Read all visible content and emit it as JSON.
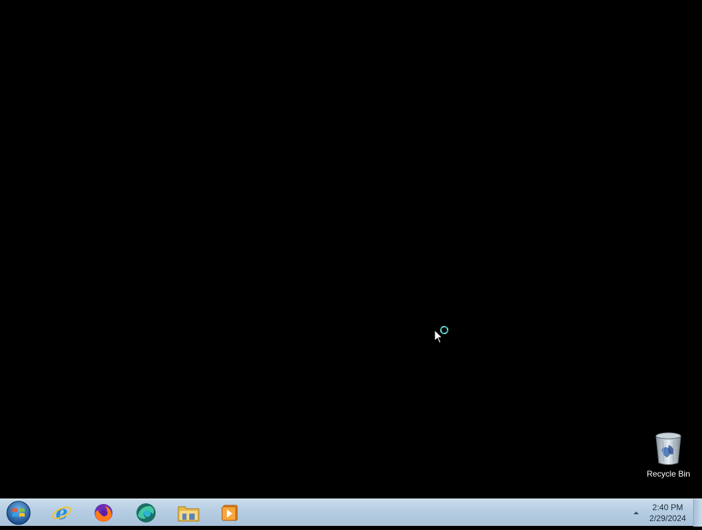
{
  "desktop": {
    "background_color": "#000000",
    "icons": [
      {
        "label": "Recycle Bin",
        "icon": "recycle-bin-icon"
      }
    ],
    "cursor": "busy-pointer-icon"
  },
  "taskbar": {
    "start_button_icon": "windows-start-orb-icon",
    "pinned": [
      {
        "name": "Internet Explorer",
        "icon": "internet-explorer-icon"
      },
      {
        "name": "Firefox",
        "icon": "firefox-icon"
      },
      {
        "name": "Browser",
        "icon": "browser-icon"
      },
      {
        "name": "Windows Explorer",
        "icon": "folder-icon"
      },
      {
        "name": "Media Player",
        "icon": "media-player-icon"
      }
    ],
    "tray": {
      "expand_icon": "chevron-up-icon",
      "time": "2:40 PM",
      "date": "2/29/2024"
    }
  },
  "colors": {
    "taskbar_top": "#c9dcec",
    "taskbar_bottom": "#a9c3da",
    "desktop": "#000000"
  }
}
